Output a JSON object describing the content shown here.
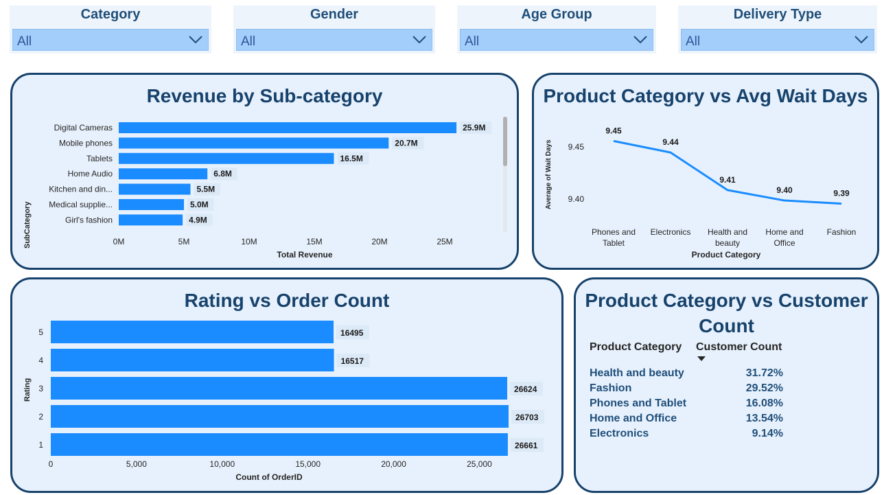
{
  "slicers": [
    {
      "title": "Category",
      "value": "All"
    },
    {
      "title": "Gender",
      "value": "All"
    },
    {
      "title": "Age Group",
      "value": "All"
    },
    {
      "title": "Delivery Type",
      "value": "All"
    }
  ],
  "revenue_chart": {
    "title": "Revenue by Sub-category",
    "ylabel": "SubCategory",
    "xlabel": "Total Revenue"
  },
  "wait_chart": {
    "title": "Product Category vs Avg Wait Days",
    "ylabel": "Average of Wait Days",
    "xlabel": "Product Category"
  },
  "rating_chart": {
    "title": "Rating vs Order Count",
    "ylabel": "Rating",
    "xlabel": "Count of OrderID"
  },
  "customer_table": {
    "title_line1": "Product Category vs Customer",
    "title_line2": "Count",
    "col1": "Product Category",
    "col2": "Customer Count",
    "rows": [
      {
        "category": "Health and beauty",
        "value": "31.72%"
      },
      {
        "category": "Fashion",
        "value": "29.52%"
      },
      {
        "category": "Phones and Tablet",
        "value": "16.08%"
      },
      {
        "category": "Home and Office",
        "value": "13.54%"
      },
      {
        "category": "Electronics",
        "value": "9.14%"
      }
    ]
  },
  "colors": {
    "bar": "#1a8cff",
    "title": "#17426b",
    "card_bg": "#e7f1fd",
    "slicer_box": "#a3cdfb"
  },
  "chart_data": [
    {
      "type": "bar",
      "orientation": "horizontal",
      "title": "Revenue by Sub-category",
      "xlabel": "Total Revenue",
      "ylabel": "SubCategory",
      "categories": [
        "Digital Cameras",
        "Mobile phones",
        "Tablets",
        "Home Audio",
        "Kitchen and din...",
        "Medical supplie...",
        "Girl's fashion"
      ],
      "values": [
        25.9,
        20.7,
        16.5,
        6.8,
        5.5,
        5.0,
        4.9
      ],
      "data_labels": [
        "25.9M",
        "20.7M",
        "16.5M",
        "6.8M",
        "5.5M",
        "5.0M",
        "4.9M"
      ],
      "xticks": [
        "0M",
        "5M",
        "10M",
        "15M",
        "20M",
        "25M"
      ],
      "xlim": [
        0,
        28
      ]
    },
    {
      "type": "line",
      "title": "Product Category vs Avg Wait Days",
      "xlabel": "Product Category",
      "ylabel": "Average of Wait Days",
      "categories": [
        "Phones and Tablet",
        "Electronics",
        "Health and beauty",
        "Home and Office",
        "Fashion"
      ],
      "category_lines": [
        [
          "Phones and",
          "Tablet"
        ],
        [
          "Electronics"
        ],
        [
          "Health and",
          "beauty"
        ],
        [
          "Home and",
          "Office"
        ],
        [
          "Fashion"
        ]
      ],
      "values": [
        9.455,
        9.444,
        9.408,
        9.398,
        9.395
      ],
      "data_labels": [
        "9.45",
        "9.44",
        "9.41",
        "9.40",
        "9.39"
      ],
      "yticks": [
        9.4,
        9.45
      ],
      "ytick_labels": [
        "9.40",
        "9.45"
      ],
      "ylim": [
        9.385,
        9.47
      ]
    },
    {
      "type": "bar",
      "orientation": "horizontal",
      "title": "Rating vs Order Count",
      "xlabel": "Count of OrderID",
      "ylabel": "Rating",
      "categories": [
        "5",
        "4",
        "3",
        "2",
        "1"
      ],
      "values": [
        16495,
        16517,
        26624,
        26703,
        26661
      ],
      "data_labels": [
        "16495",
        "16517",
        "26624",
        "26703",
        "26661"
      ],
      "xticks": [
        0,
        5000,
        10000,
        15000,
        20000,
        25000
      ],
      "xtick_labels": [
        "0",
        "5,000",
        "10,000",
        "15,000",
        "20,000",
        "25,000"
      ],
      "xlim": [
        0,
        26703
      ]
    },
    {
      "type": "table",
      "title": "Product Category vs Customer Count",
      "columns": [
        "Product Category",
        "Customer Count"
      ],
      "rows": [
        [
          "Health and beauty",
          31.72
        ],
        [
          "Fashion",
          29.52
        ],
        [
          "Phones and Tablet",
          16.08
        ],
        [
          "Home and Office",
          13.54
        ],
        [
          "Electronics",
          9.14
        ]
      ]
    }
  ]
}
